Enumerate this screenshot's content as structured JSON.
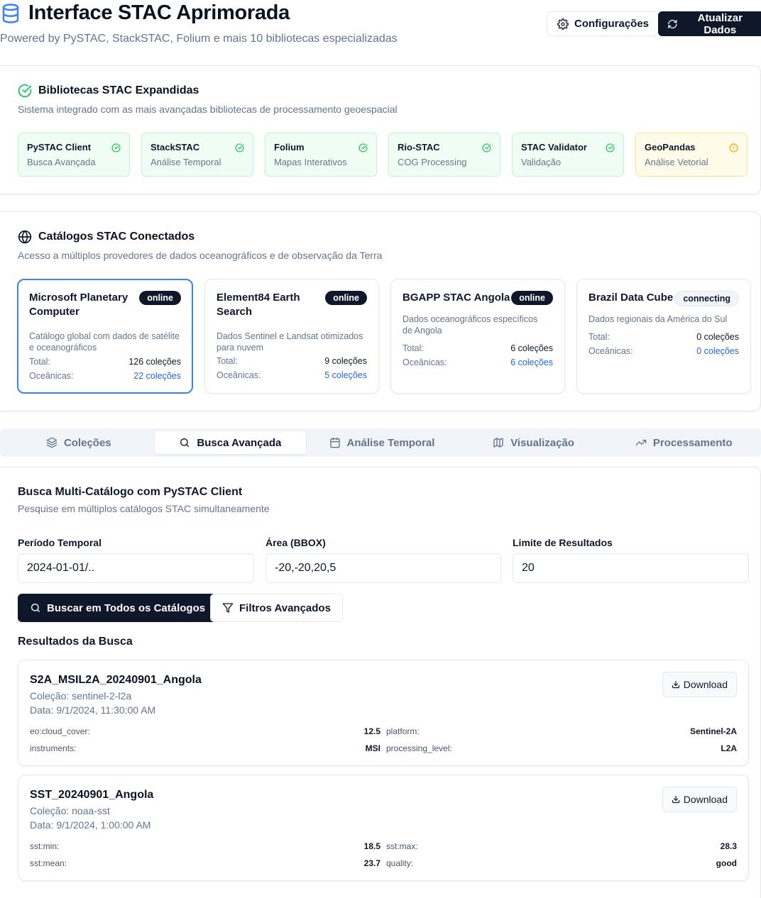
{
  "header": {
    "title": "Interface STAC Aprimorada",
    "subtitle": "Powered by PySTAC, StackSTAC, Folium e mais 10 bibliotecas especializadas",
    "settings_label": "Configurações",
    "refresh_label": "Atualizar Dados"
  },
  "libraries": {
    "title": "Bibliotecas STAC Expandidas",
    "description": "Sistema integrado com as mais avançadas bibliotecas de processamento geoespacial",
    "items": [
      {
        "name": "PySTAC Client",
        "sub": "Busca Avançada",
        "status": "ok"
      },
      {
        "name": "StackSTAC",
        "sub": "Análise Temporal",
        "status": "ok"
      },
      {
        "name": "Folium",
        "sub": "Mapas Interativos",
        "status": "ok"
      },
      {
        "name": "Rio-STAC",
        "sub": "COG Processing",
        "status": "ok"
      },
      {
        "name": "STAC Validator",
        "sub": "Validação",
        "status": "ok"
      },
      {
        "name": "GeoPandas",
        "sub": "Análise Vetorial",
        "status": "warning"
      }
    ]
  },
  "catalogs": {
    "title": "Catálogos STAC Conectados",
    "description": "Acesso a múltiplos provedores de dados oceanográficos e de observação da Terra",
    "total_label": "Total:",
    "ocean_label": "Oceânicas:",
    "items": [
      {
        "name": "Microsoft Planetary Computer",
        "status": "online",
        "desc": "Catálogo global com dados de satélite e oceanográficos",
        "total": "126 coleções",
        "ocean": "22 coleções"
      },
      {
        "name": "Element84 Earth Search",
        "status": "online",
        "desc": "Dados Sentinel e Landsat otimizados para nuvem",
        "total": "9 coleções",
        "ocean": "5 coleções"
      },
      {
        "name": "BGAPP STAC Angola",
        "status": "online",
        "desc": "Dados oceanográficos específicos de Angola",
        "total": "6 coleções",
        "ocean": "6 coleções"
      },
      {
        "name": "Brazil Data Cube",
        "status": "connecting",
        "desc": "Dados regionais da América do Sul",
        "total": "0 coleções",
        "ocean": "0 coleções"
      }
    ]
  },
  "tabs": [
    {
      "label": "Coleções",
      "icon": "layers-icon"
    },
    {
      "label": "Busca Avançada",
      "icon": "search-icon",
      "active": true
    },
    {
      "label": "Análise Temporal",
      "icon": "calendar-icon"
    },
    {
      "label": "Visualização",
      "icon": "map-icon"
    },
    {
      "label": "Processamento",
      "icon": "trending-up-icon"
    }
  ],
  "search": {
    "title": "Busca Multi-Catálogo com PySTAC Client",
    "description": "Pesquise em múltiplos catálogos STAC simultaneamente",
    "period_label": "Período Temporal",
    "period_value": "2024-01-01/..",
    "bbox_label": "Área (BBOX)",
    "bbox_value": "-20,-20,20,5",
    "limit_label": "Limite de Resultados",
    "limit_value": "20",
    "search_button": "Buscar em Todos os Catálogos",
    "filters_button": "Filtros Avançados",
    "results_title": "Resultados da Busca",
    "download_label": "Download",
    "results": [
      {
        "name": "S2A_MSIL2A_20240901_Angola",
        "collection": "Coleção: sentinel-2-l2a",
        "date": "Data: 9/1/2024, 11:30:00 AM",
        "props": [
          {
            "k": "eo:cloud_cover:",
            "v": "12.5"
          },
          {
            "k": "platform:",
            "v": "Sentinel-2A"
          },
          {
            "k": "instruments:",
            "v": "MSI"
          },
          {
            "k": "processing_level:",
            "v": "L2A"
          }
        ]
      },
      {
        "name": "SST_20240901_Angola",
        "collection": "Coleção: noaa-sst",
        "date": "Data: 9/1/2024, 1:00:00 AM",
        "props": [
          {
            "k": "sst:min:",
            "v": "18.5"
          },
          {
            "k": "sst:max:",
            "v": "28.3"
          },
          {
            "k": "sst:mean:",
            "v": "23.7"
          },
          {
            "k": "quality:",
            "v": "good"
          }
        ]
      }
    ]
  }
}
